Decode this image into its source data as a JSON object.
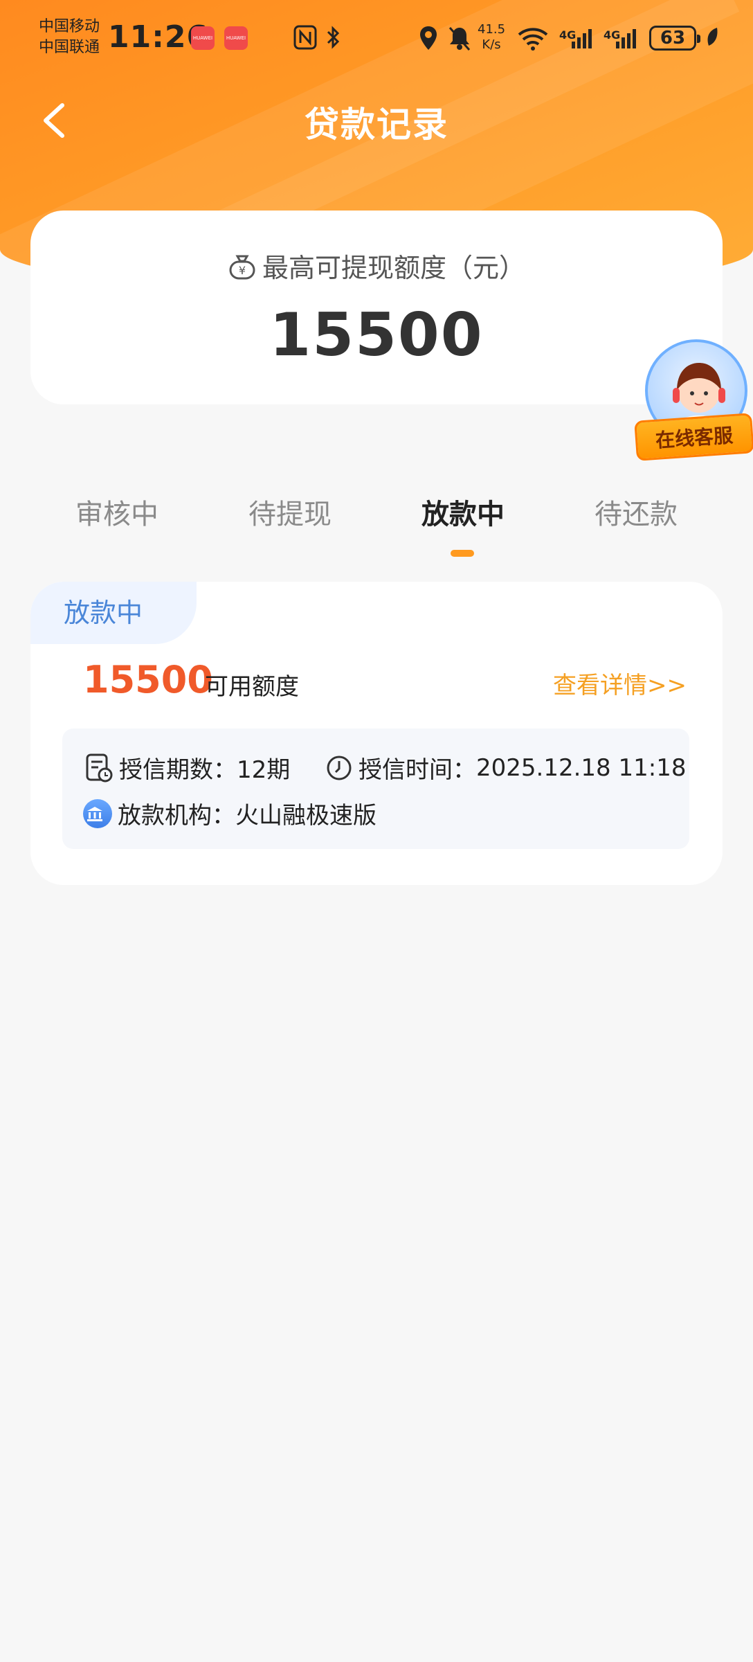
{
  "status_bar": {
    "carrier_1": "中国移动",
    "carrier_2": "中国联通",
    "time": "11:26",
    "app_badge": "HUAWEI",
    "net_speed_value": "41.5",
    "net_speed_unit": "K/s",
    "signal_1": "4G",
    "signal_2": "4G",
    "battery": "63"
  },
  "header": {
    "title": "贷款记录"
  },
  "quota": {
    "label": "最高可提现额度（元）",
    "value": "15500"
  },
  "service": {
    "label": "在线客服"
  },
  "tabs": [
    {
      "label": "审核中",
      "active": false
    },
    {
      "label": "待提现",
      "active": false
    },
    {
      "label": "放款中",
      "active": true
    },
    {
      "label": "待还款",
      "active": false
    }
  ],
  "record": {
    "status": "放款中",
    "amount": "15500",
    "amount_label": "可用额度",
    "detail_link": "查看详情>>",
    "term_label": "授信期数：",
    "term_value": "12期",
    "time_label": "授信时间：",
    "time_value": "2025.12.18 11:18",
    "lender_label": "放款机构：",
    "lender_value": "火山融极速版"
  },
  "colors": {
    "header_orange": "#ff9a26",
    "amount_red": "#f05a2a",
    "link_orange": "#f5a023",
    "tag_blue": "#4a86d8"
  }
}
